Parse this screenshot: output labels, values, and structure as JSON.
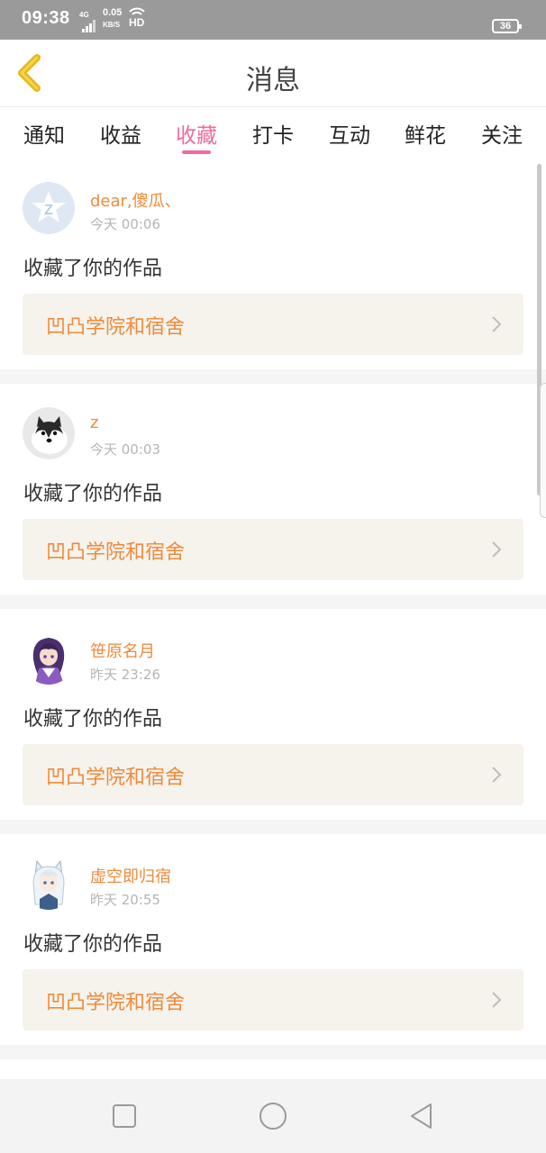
{
  "status_bar": {
    "time": "09:38",
    "network": "4G",
    "speed_value": "0.05",
    "speed_unit": "KB/S",
    "hd": "HD",
    "battery": "36"
  },
  "header": {
    "title": "消息"
  },
  "tabs": [
    {
      "label": "通知",
      "active": false
    },
    {
      "label": "收益",
      "active": false
    },
    {
      "label": "收藏",
      "active": true
    },
    {
      "label": "打卡",
      "active": false
    },
    {
      "label": "互动",
      "active": false
    },
    {
      "label": "鲜花",
      "active": false
    },
    {
      "label": "关注",
      "active": false
    }
  ],
  "messages": [
    {
      "username": "dear,傻瓜、",
      "time": "今天 00:06",
      "action": "收藏了你的作品",
      "work": "凹凸学院和宿舍",
      "avatar": "qzone-default-avatar"
    },
    {
      "username": "z",
      "time": "今天 00:03",
      "action": "收藏了你的作品",
      "work": "凹凸学院和宿舍",
      "avatar": "husky-dog-avatar"
    },
    {
      "username": "笹原名月",
      "time": "昨天 23:26",
      "action": "收藏了你的作品",
      "work": "凹凸学院和宿舍",
      "avatar": "purple-hair-anime-girl-avatar"
    },
    {
      "username": "虚空即归宿",
      "time": "昨天 20:55",
      "action": "收藏了你的作品",
      "work": "凹凸学院和宿舍",
      "avatar": "white-hair-anime-catgirl-avatar"
    }
  ],
  "colors": {
    "accent_pink": "#f06aa0",
    "accent_orange": "#f08a3c",
    "back_arrow": "#e8b820",
    "work_bg": "#f5f3ec"
  },
  "nav_bar": {
    "buttons": [
      "recent-apps",
      "home",
      "back"
    ]
  }
}
